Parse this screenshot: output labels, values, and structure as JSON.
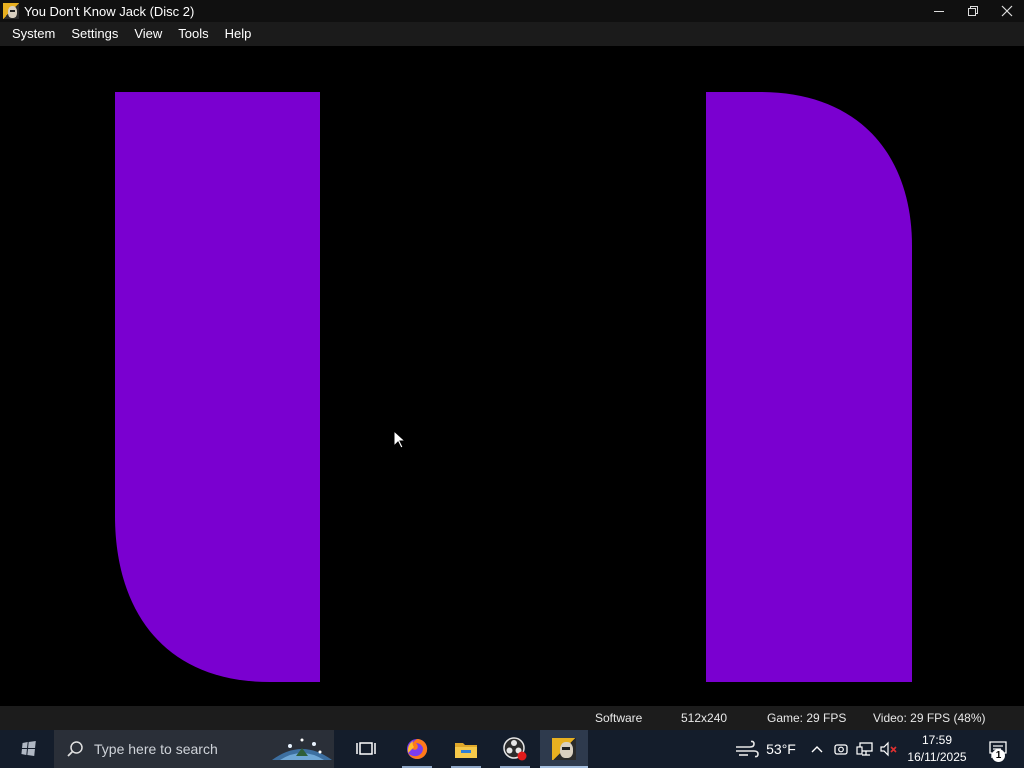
{
  "window": {
    "title": "You Don't Know Jack (Disc 2)",
    "app_icon": "ydkj-app-icon"
  },
  "menu": {
    "items": [
      "System",
      "Settings",
      "View",
      "Tools",
      "Help"
    ]
  },
  "game_screen": {
    "background_color": "#000000",
    "shape_color": "#7a00d0",
    "shapes": [
      "left-rounded-bottom-panel",
      "right-rounded-top-panel"
    ]
  },
  "status_bar": {
    "renderer": "Software",
    "resolution": "512x240",
    "game_fps": "Game: 29 FPS",
    "video_fps": "Video: 29 FPS (48%)"
  },
  "taskbar": {
    "search_placeholder": "Type here to search",
    "apps": [
      "windows-start-icon",
      "task-view-icon",
      "firefox-icon",
      "file-explorer-icon",
      "obs-icon",
      "ydkj-app-icon"
    ],
    "weather": "53°F",
    "time": "17:59",
    "date": "16/11/2025",
    "notification_count": "1",
    "accent_color": "#141d2b"
  }
}
